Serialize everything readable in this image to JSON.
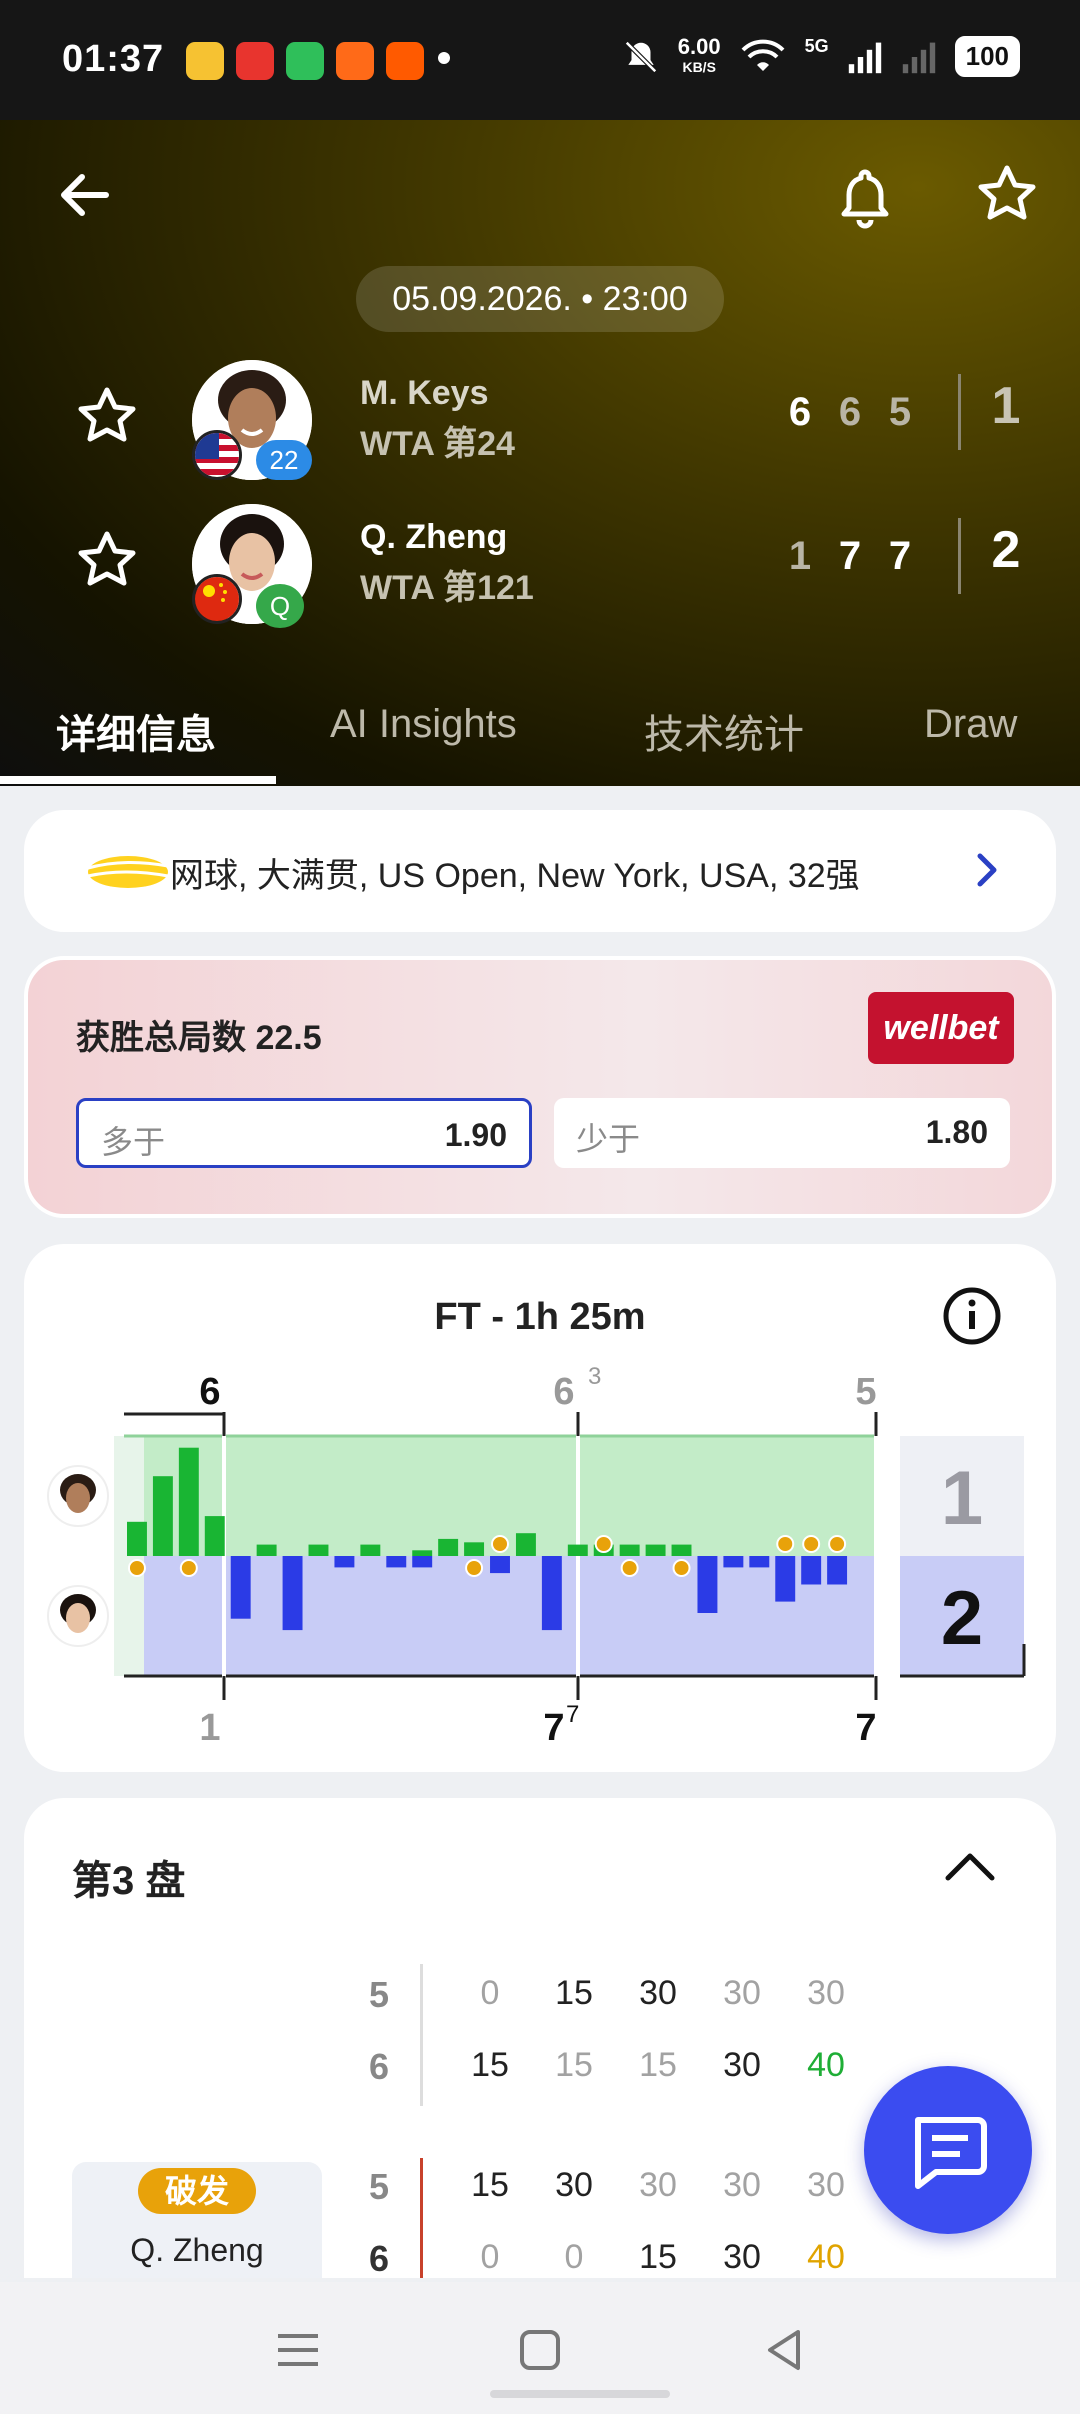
{
  "status_bar": {
    "time": "01:37",
    "speed": "6.00",
    "speed_unit": "KB/S",
    "network": "5G",
    "battery": "100"
  },
  "match": {
    "date": "05.09.2026. • 23:00",
    "players": [
      {
        "name": "M. Keys",
        "rank": "WTA 第24",
        "seed": "22",
        "sets": [
          "6",
          "6",
          "5"
        ],
        "set_wins": [
          true,
          false,
          false
        ],
        "total": "1"
      },
      {
        "name": "Q. Zheng",
        "rank": "WTA 第121",
        "seed": "Q",
        "sets": [
          "1",
          "7",
          "7"
        ],
        "set_wins": [
          false,
          true,
          true
        ],
        "total": "2"
      }
    ]
  },
  "tabs": [
    "详细信息",
    "AI Insights",
    "技术统计",
    "Draw"
  ],
  "tournament": {
    "text": "网球, 大满贯, US Open, New York, USA, 32强"
  },
  "betting": {
    "title": "获胜总局数 22.5",
    "brand": "wellbet",
    "over_label": "多于",
    "over_value": "1.90",
    "under_label": "少于",
    "under_value": "1.80"
  },
  "momentum": {
    "title": "FT - 1h 25m",
    "top_scores": [
      {
        "main": "6",
        "sup": ""
      },
      {
        "main": "6",
        "sup": "3"
      },
      {
        "main": "5",
        "sup": ""
      }
    ],
    "bottom_scores": [
      {
        "main": "1",
        "sup": ""
      },
      {
        "main": "7",
        "sup": "7"
      },
      {
        "main": "7",
        "sup": ""
      }
    ],
    "final_top": "1",
    "final_bottom": "2",
    "top_bars": [
      0.3,
      0.7,
      0.95,
      0.35,
      0,
      0.1,
      0,
      0.1,
      0,
      0.1,
      0,
      0.05,
      0.15,
      0.12,
      0,
      0.2,
      0,
      0.1,
      0.1,
      0.1,
      0.1,
      0.1,
      0,
      0,
      0,
      0,
      0,
      0,
      0
    ],
    "bottom_bars": [
      0,
      0,
      0,
      0,
      0.55,
      0,
      0.65,
      0,
      0.1,
      0,
      0.1,
      0.1,
      0,
      0,
      0.15,
      0,
      0.65,
      0,
      0,
      0,
      0,
      0,
      0.5,
      0.1,
      0.1,
      0.4,
      0.25,
      0.25,
      0
    ],
    "ball_top": [
      14,
      18,
      25,
      26,
      27
    ],
    "ball_bottom": [
      0,
      2,
      13,
      19,
      21
    ]
  },
  "set3": {
    "title": "第3 盘",
    "rows": [
      {
        "games": "5",
        "games_dark": false,
        "points": [
          "0",
          "15",
          "30",
          "30",
          "30"
        ],
        "styles": [
          "dim",
          "",
          "",
          "dim",
          "dim"
        ]
      },
      {
        "games": "6",
        "games_dark": false,
        "points": [
          "15",
          "15",
          "15",
          "30",
          "40"
        ],
        "styles": [
          "",
          "dim",
          "dim",
          "",
          "green"
        ]
      },
      {
        "games": "5",
        "games_dark": false,
        "points": [
          "15",
          "30",
          "30",
          "30",
          "30"
        ],
        "styles": [
          "",
          "",
          "dim",
          "dim",
          "dim"
        ]
      },
      {
        "games": "6",
        "games_dark": true,
        "points": [
          "0",
          "0",
          "15",
          "30",
          "40"
        ],
        "styles": [
          "dim",
          "dim",
          "",
          "",
          "yellow"
        ]
      }
    ],
    "break_label": "破发",
    "break_player": "Q. Zheng"
  },
  "colors": {
    "accent": "#3b4cf0",
    "green_bar": "#19b533",
    "blue_bar": "#2b3be6",
    "brand_red": "#c4122f"
  }
}
